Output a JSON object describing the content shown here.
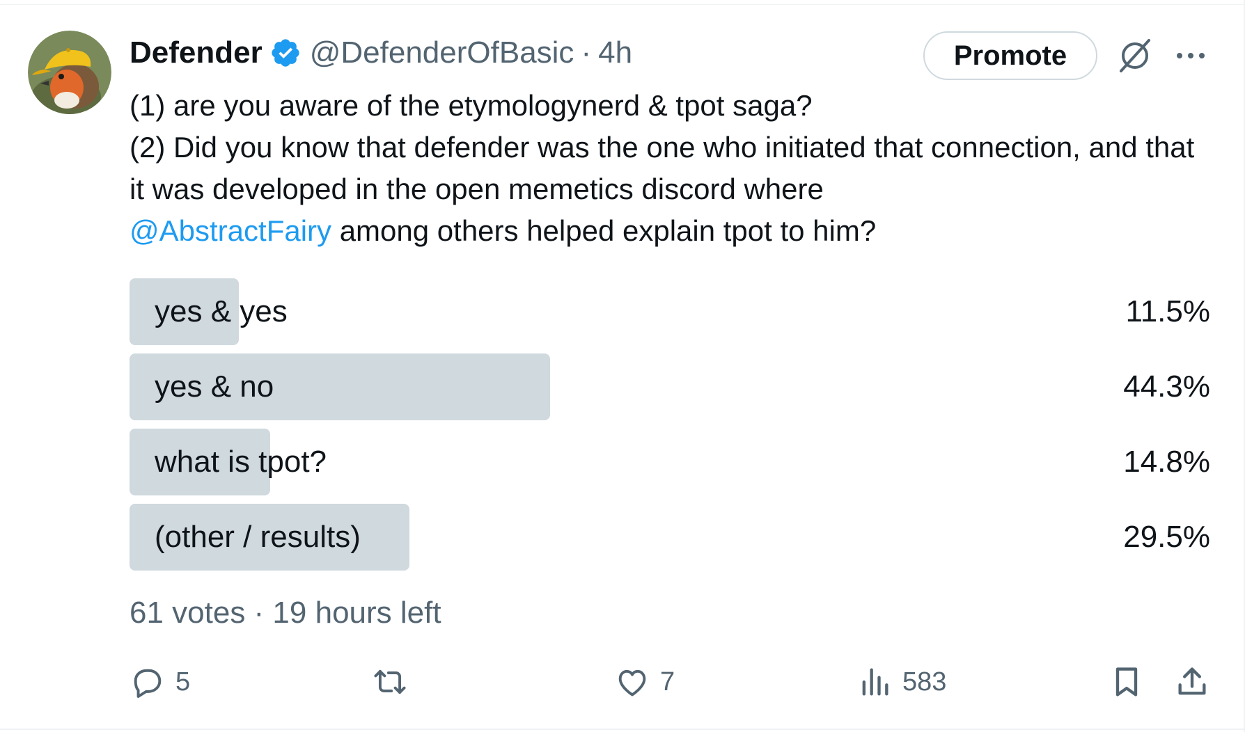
{
  "tweet": {
    "author_name": "Defender",
    "handle": "@DefenderOfBasic",
    "separator": "·",
    "time": "4h",
    "promote_label": "Promote",
    "line1": "(1) are you aware of the etymologynerd & tpot saga?",
    "line2": "(2) Did you know that defender was the one who initiated that connection, and that it was developed in the open memetics discord where",
    "mention": "@AbstractFairy",
    "line2_tail": " among others helped explain tpot to him?"
  },
  "poll": {
    "options": [
      {
        "label": "yes & yes",
        "percent_text": "11.5%",
        "percent": 11.5
      },
      {
        "label": "yes & no",
        "percent_text": "44.3%",
        "percent": 44.3
      },
      {
        "label": "what is tpot?",
        "percent_text": "14.8%",
        "percent": 14.8
      },
      {
        "label": "(other / results)",
        "percent_text": "29.5%",
        "percent": 29.5
      }
    ],
    "meta": "61 votes · 19 hours left"
  },
  "actions": {
    "replies": "5",
    "likes": "7",
    "views": "583"
  },
  "colors": {
    "accent": "#1d9bf0",
    "text": "#0f1419",
    "secondary_text": "#536471",
    "poll_bar": "#cfd9de"
  },
  "icons": [
    "verified-badge-icon",
    "grok-icon",
    "more-icon",
    "reply-icon",
    "retweet-icon",
    "like-icon",
    "views-icon",
    "bookmark-icon",
    "share-icon"
  ]
}
